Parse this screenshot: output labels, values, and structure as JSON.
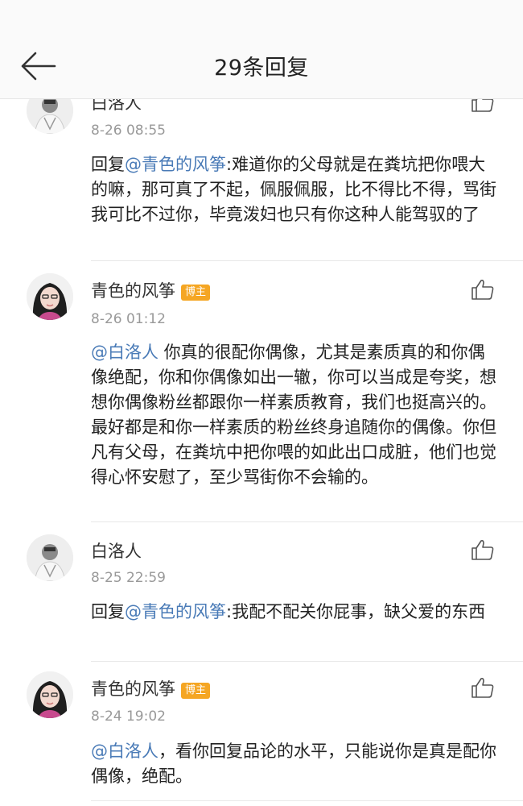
{
  "header": {
    "title": "29条回复",
    "back_icon": "arrow-left-icon"
  },
  "comments": [
    {
      "author": "白洛人",
      "badge": "",
      "time": "8-26 08:55",
      "prefix": "回复",
      "mention": "@青色的风筝",
      "body": ":难道你的父母就是在粪坑把你喂大的嘛，那可真了不起，佩服佩服，比不得比不得，骂街我可比不过你，毕竟泼妇也只有你这种人能驾驭的了",
      "like_icon": "thumbs-up-icon"
    },
    {
      "author": "青色的风筝",
      "badge": "博主",
      "time": "8-26 01:12",
      "prefix": "",
      "mention": "@白洛人",
      "body": " 你真的很配你偶像，尤其是素质真的和你偶像绝配，你和你偶像如出一辙，你可以当成是夸奖，想想你偶像粉丝都跟你一样素质教育，我们也挺高兴的。最好都是和你一样素质的粉丝终身追随你的偶像。你但凡有父母，在粪坑中把你喂的如此出口成脏，他们也觉得心怀安慰了，至少骂街你不会输的。",
      "like_icon": "thumbs-up-icon"
    },
    {
      "author": "白洛人",
      "badge": "",
      "time": "8-25 22:59",
      "prefix": "回复",
      "mention": "@青色的风筝",
      "body": ":我配不配关你屁事，缺父爱的东西",
      "like_icon": "thumbs-up-icon"
    },
    {
      "author": "青色的风筝",
      "badge": "博主",
      "time": "8-24 19:02",
      "prefix": "",
      "mention": "@白洛人",
      "body": "，看你回复品论的水平，只能说你是真是配你偶像，绝配。",
      "like_icon": "thumbs-up-icon"
    }
  ],
  "colors": {
    "mention": "#4a7bb7",
    "badge": "#f5a623",
    "timestamp": "#999999"
  }
}
